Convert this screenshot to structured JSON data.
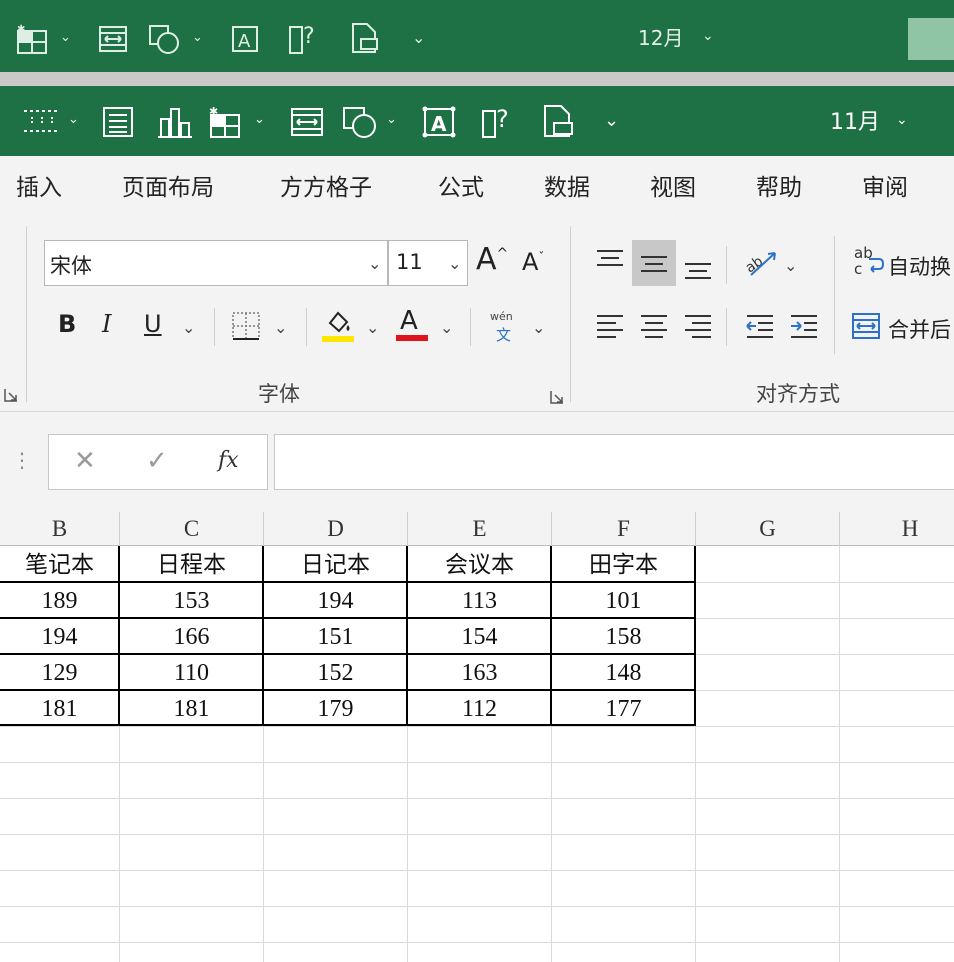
{
  "back_window": {
    "title": "12月"
  },
  "window": {
    "title": "11月"
  },
  "ribbon_tabs": [
    "插入",
    "页面布局",
    "方方格子",
    "公式",
    "数据",
    "视图",
    "帮助",
    "审阅"
  ],
  "font_group": {
    "font_name": "宋体",
    "font_size": "11",
    "bold": "B",
    "italic": "I",
    "underline": "U",
    "grow": "A",
    "shrink": "A",
    "font_color_letter": "A",
    "phonetic_top": "wén",
    "phonetic_bottom": "文",
    "label": "字体",
    "fill_color": "#ffe600",
    "font_color": "#e0141e"
  },
  "align_group": {
    "wrap_text": "自动换",
    "merge": "合并后",
    "label": "对齐方式",
    "ab_top": "ab",
    "ab_bottom": "c"
  },
  "formula_bar": {
    "cancel": "✕",
    "enter": "✓",
    "fx": "fx",
    "value": ""
  },
  "grid": {
    "columns": [
      "B",
      "C",
      "D",
      "E",
      "F",
      "G",
      "H"
    ],
    "headers": [
      "笔记本",
      "日程本",
      "日记本",
      "会议本",
      "田字本"
    ],
    "rows": [
      [
        "189",
        "153",
        "194",
        "113",
        "101"
      ],
      [
        "194",
        "166",
        "151",
        "154",
        "158"
      ],
      [
        "129",
        "110",
        "152",
        "163",
        "148"
      ],
      [
        "181",
        "181",
        "179",
        "112",
        "177"
      ]
    ]
  },
  "colors": {
    "excel_green": "#1e7145",
    "ribbon_bg": "#f3f3f3"
  }
}
